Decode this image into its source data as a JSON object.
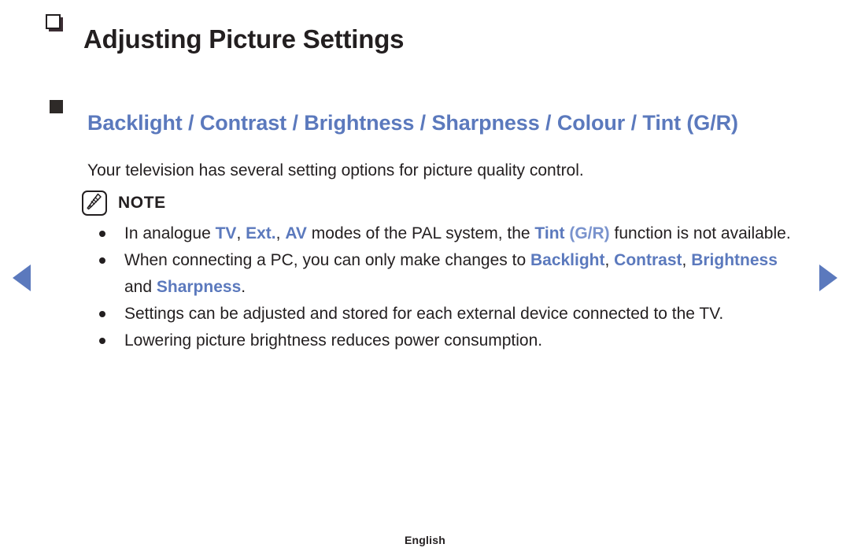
{
  "page": {
    "title": "Adjusting Picture Settings",
    "title_bullet_icon": "square-3d-icon",
    "subheading": "Backlight / Contrast / Brightness / Sharpness / Colour / Tint (G/R)",
    "subheading_bullet_icon": "square-filled-icon",
    "subheading_color": "#5b79bd",
    "description": "Your television has several setting options for picture quality control.",
    "note": {
      "icon": "note-pen-icon",
      "label": "NOTE",
      "items": [
        {
          "segments": [
            {
              "text": "In analogue ",
              "style": "plain"
            },
            {
              "text": "TV",
              "style": "keyword"
            },
            {
              "text": ", ",
              "style": "plain"
            },
            {
              "text": "Ext.",
              "style": "keyword"
            },
            {
              "text": ", ",
              "style": "plain"
            },
            {
              "text": "AV",
              "style": "keyword"
            },
            {
              "text": " modes of the PAL system, the ",
              "style": "plain"
            },
            {
              "text": "Tint",
              "style": "keyword"
            },
            {
              "text": " ",
              "style": "plain"
            },
            {
              "text": "(G/R)",
              "style": "keyword-light"
            },
            {
              "text": " function is not available.",
              "style": "plain"
            }
          ]
        },
        {
          "segments": [
            {
              "text": "When connecting a PC, you can only make changes to ",
              "style": "plain"
            },
            {
              "text": "Backlight",
              "style": "keyword"
            },
            {
              "text": ", ",
              "style": "plain"
            },
            {
              "text": "Contrast",
              "style": "keyword"
            },
            {
              "text": ", ",
              "style": "plain"
            },
            {
              "text": "Brightness",
              "style": "keyword"
            },
            {
              "text": " and ",
              "style": "plain"
            },
            {
              "text": "Sharpness",
              "style": "keyword"
            },
            {
              "text": ".",
              "style": "plain"
            }
          ]
        },
        {
          "segments": [
            {
              "text": "Settings can be adjusted and stored for each external device connected to the TV.",
              "style": "plain"
            }
          ]
        },
        {
          "segments": [
            {
              "text": "Lowering picture brightness reduces power consumption.",
              "style": "plain"
            }
          ]
        }
      ]
    },
    "nav": {
      "prev_label": "◀",
      "next_label": "▶",
      "prev_icon": "triangle-left-icon",
      "next_icon": "triangle-right-icon",
      "arrow_color": "#5b79bd"
    },
    "footer": {
      "language": "English"
    }
  }
}
